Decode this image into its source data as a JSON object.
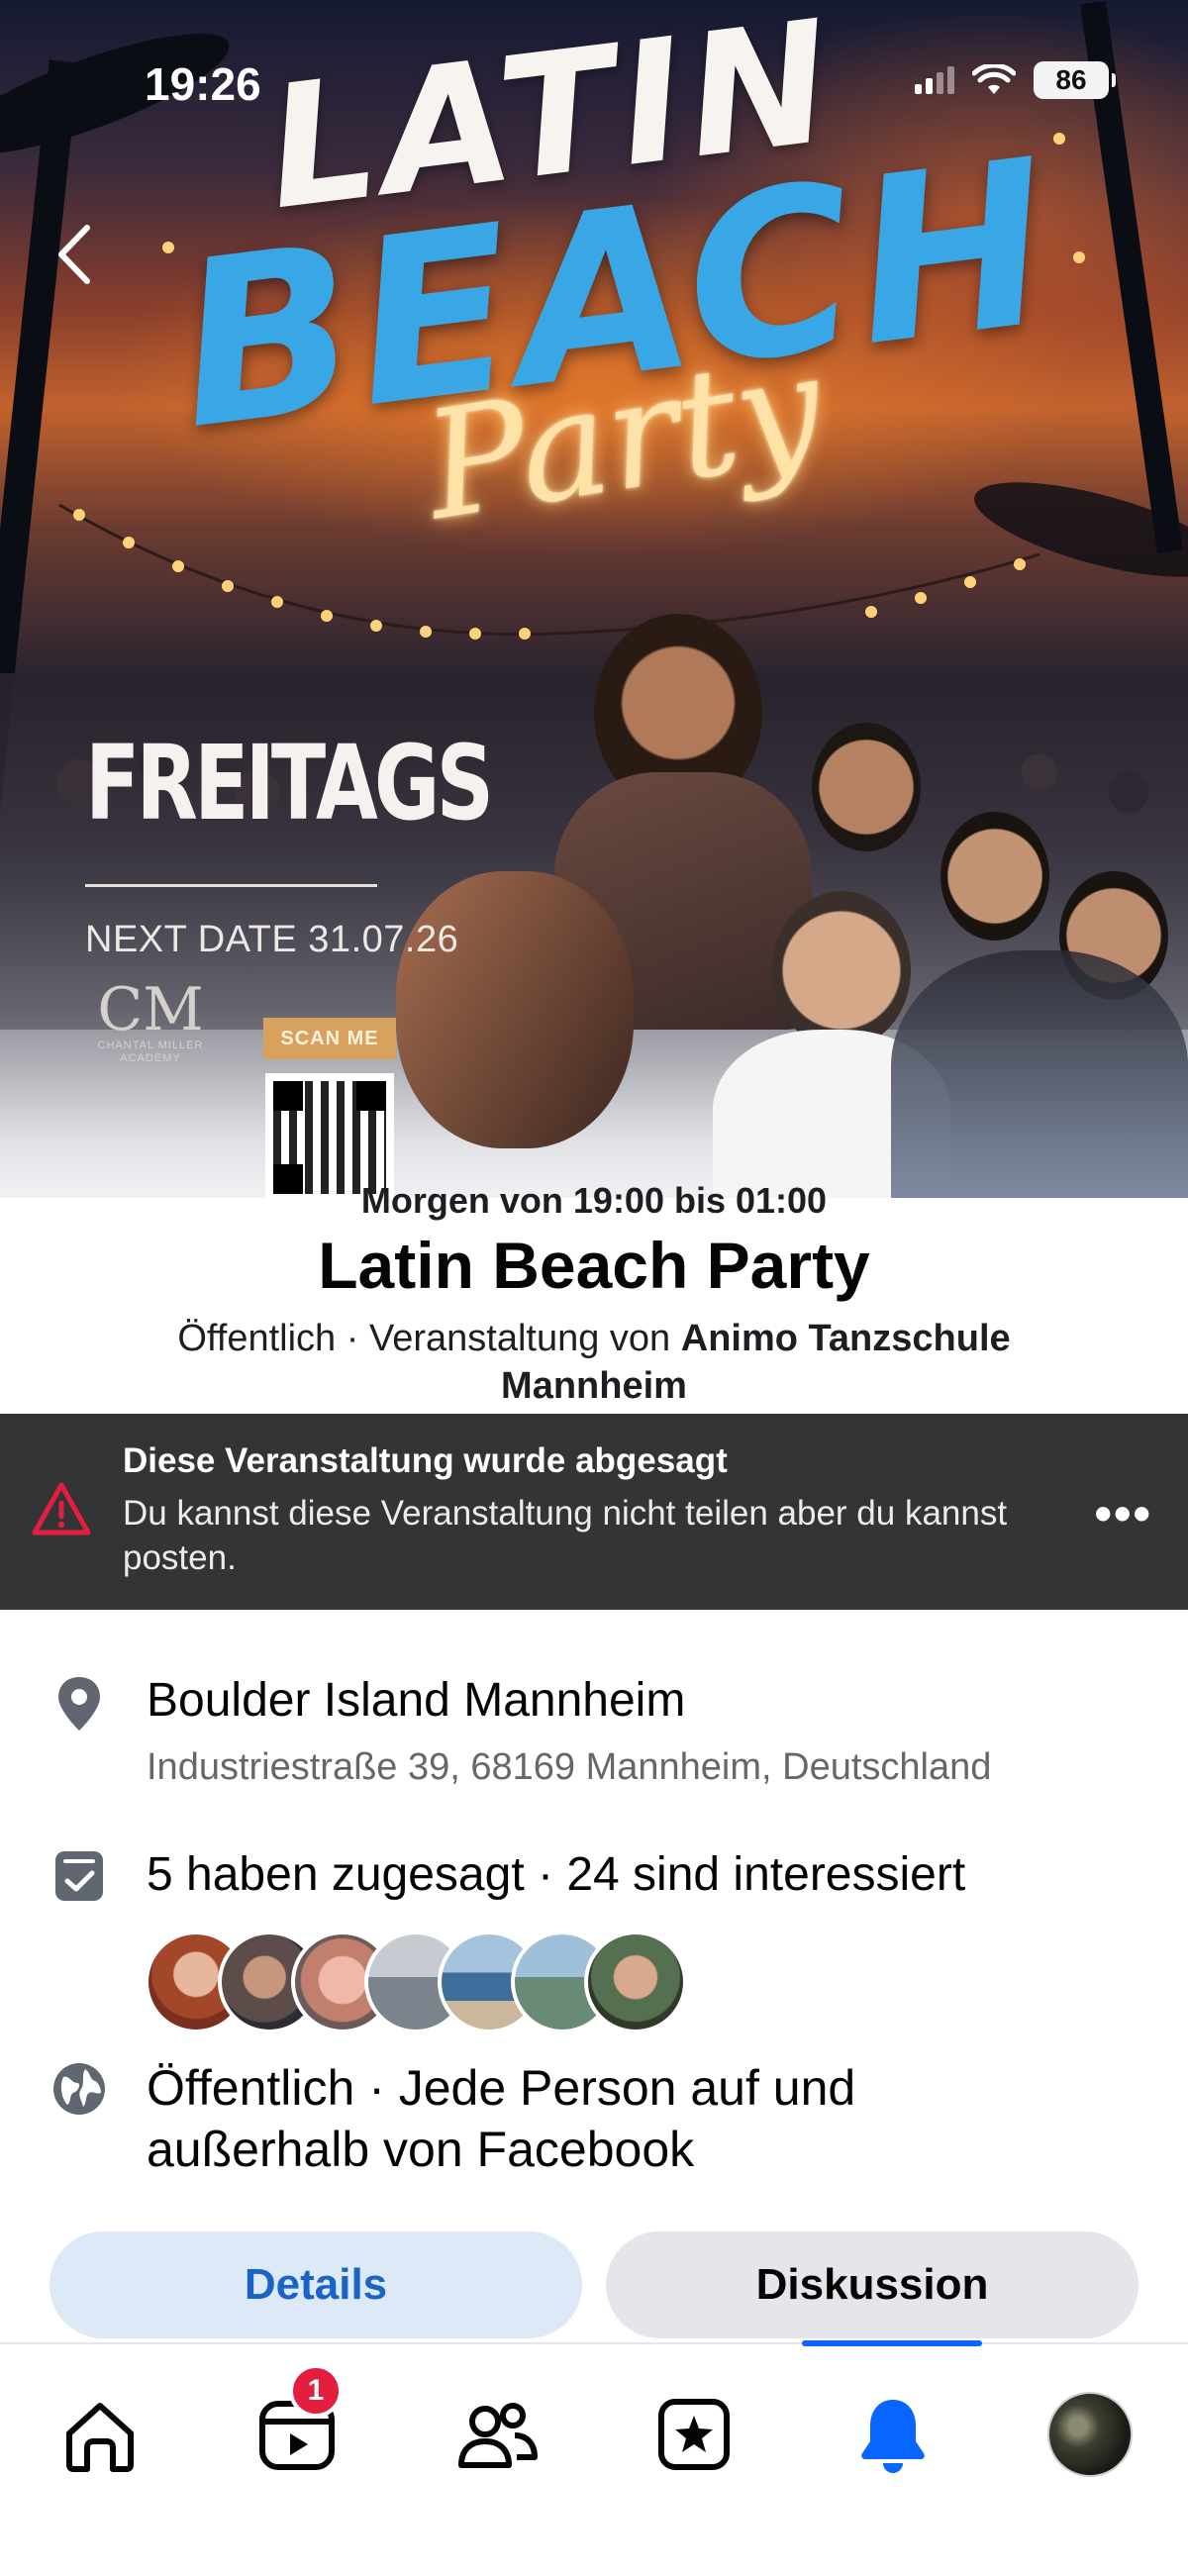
{
  "status_bar": {
    "time": "19:26",
    "battery": "86"
  },
  "poster": {
    "title_line1": "LATIN",
    "title_line2": "BEACH",
    "title_line3": "Party",
    "day": "FREITAGS",
    "next_date": "NEXT DATE 31.07.26",
    "logo_mark": "CM",
    "logo_text": "CHANTAL MILLER ACADEMY",
    "scan_label": "SCAN ME"
  },
  "event": {
    "when": "Morgen von 19:00 bis 01:00",
    "title": "Latin Beach Party",
    "visibility_prefix": "Öffentlich · Veranstaltung von ",
    "organizer": "Animo Tanzschule Mannheim"
  },
  "banner": {
    "title": "Diese Veranstaltung wurde abgesagt",
    "text": "Du kannst diese Veranstaltung nicht teilen aber du kannst posten.",
    "more": "•••"
  },
  "details": {
    "location_name": "Boulder Island Mannheim",
    "location_address": "Industriestraße 39, 68169 Mannheim, Deutschland",
    "attendance": "5 haben zugesagt · 24 sind interessiert",
    "privacy": "Öffentlich · Jede Person auf und außerhalb von Facebook"
  },
  "tabs": {
    "details": "Details",
    "discussion": "Diskussion"
  },
  "nav": {
    "video_badge": "1"
  },
  "colors": {
    "accent": "#0866ff",
    "banner_bg": "#333436",
    "warning": "#e41e3f"
  }
}
